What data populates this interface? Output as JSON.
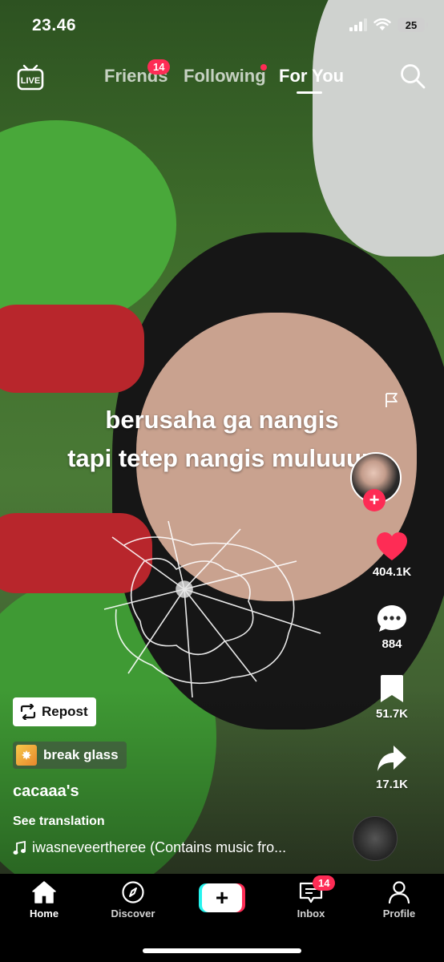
{
  "status_bar": {
    "time": "23.46",
    "battery": "25"
  },
  "top_nav": {
    "tabs": [
      {
        "label": "Friends",
        "badge": "14"
      },
      {
        "label": "Following"
      },
      {
        "label": "For You"
      }
    ]
  },
  "video": {
    "caption_line1": "berusaha ga nangis",
    "caption_line2": "tapi tetep nangis muluuuu"
  },
  "actions": {
    "likes": "404.1K",
    "comments": "884",
    "saves": "51.7K",
    "shares": "17.1K"
  },
  "post": {
    "repost_label": "Repost",
    "effect_label": "break glass",
    "username": "cacaaa's",
    "see_translation": "See translation",
    "sound": "iwasneveertheree (Contains music fro..."
  },
  "bottom_nav": {
    "home": "Home",
    "discover": "Discover",
    "inbox": "Inbox",
    "inbox_badge": "14",
    "profile": "Profile"
  },
  "colors": {
    "accent": "#fe2c55",
    "cyan": "#25f4ee"
  }
}
